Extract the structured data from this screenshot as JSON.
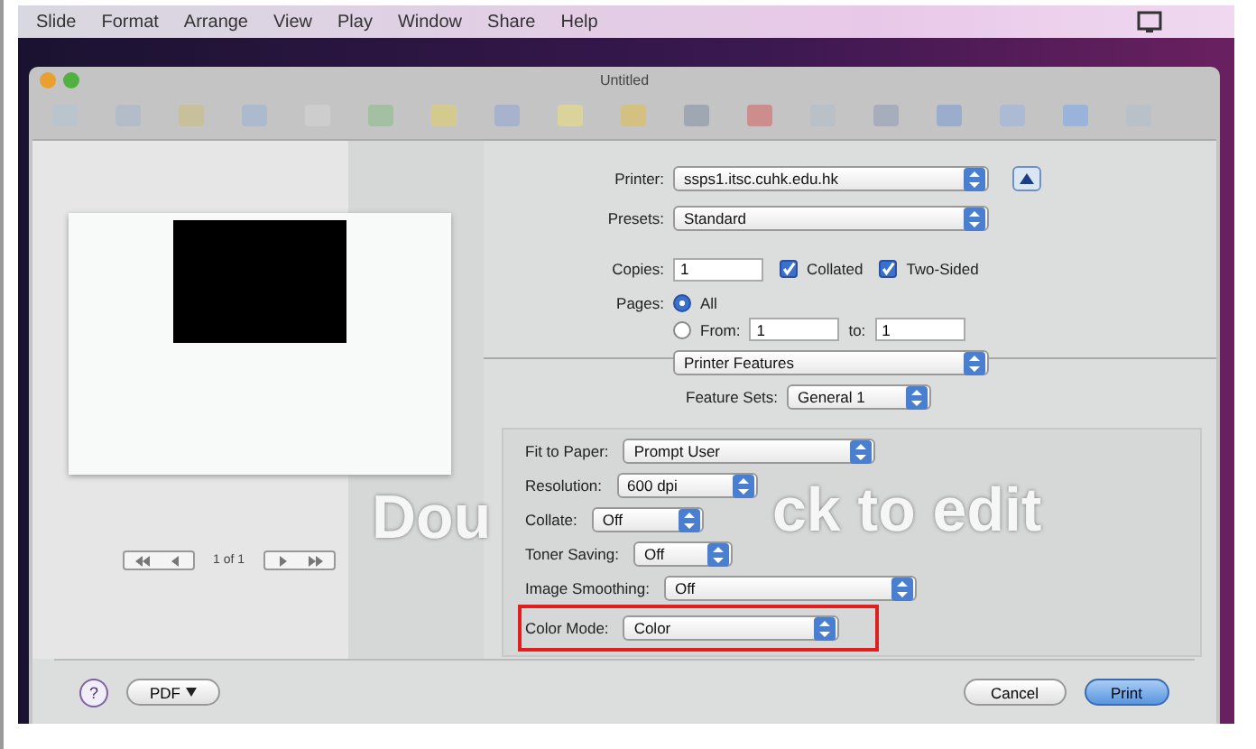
{
  "menu_bar": {
    "items": [
      "Slide",
      "Format",
      "Arrange",
      "View",
      "Play",
      "Window",
      "Share",
      "Help"
    ]
  },
  "window": {
    "title": "Untitled"
  },
  "slide_placeholder": [
    "Dou",
    "ck to edit"
  ],
  "print_dialog": {
    "printer": {
      "label": "Printer:",
      "value": "ssps1.itsc.cuhk.edu.hk"
    },
    "presets": {
      "label": "Presets:",
      "value": "Standard"
    },
    "copies": {
      "label": "Copies:",
      "value": "1"
    },
    "checkboxes": [
      {
        "label": "Collated",
        "checked": true
      },
      {
        "label": "Two-Sided",
        "checked": true
      }
    ],
    "pages": {
      "label": "Pages:",
      "options": [
        {
          "label": "All",
          "selected": true
        },
        {
          "label": "From:",
          "selected": false
        }
      ],
      "from": "1",
      "to_label": "to:",
      "to": "1"
    },
    "panel": "Printer Features",
    "feature_sets": {
      "label": "Feature Sets:",
      "value": "General 1"
    },
    "options": [
      {
        "label": "Fit to Paper:",
        "value": "Prompt User",
        "highlighted": false
      },
      {
        "label": "Resolution:",
        "value": "600 dpi",
        "highlighted": false
      },
      {
        "label": "Collate:",
        "value": "Off",
        "highlighted": false
      },
      {
        "label": "Toner Saving:",
        "value": "Off",
        "highlighted": false
      },
      {
        "label": "Image Smoothing:",
        "value": "Off",
        "highlighted": false
      },
      {
        "label": "Color Mode:",
        "value": "Color",
        "highlighted": true
      }
    ],
    "page_count": "1 of 1",
    "help": "?",
    "pdf": "PDF",
    "buttons": [
      {
        "label": "Cancel",
        "default": false
      },
      {
        "label": "Print",
        "default": true
      }
    ]
  }
}
